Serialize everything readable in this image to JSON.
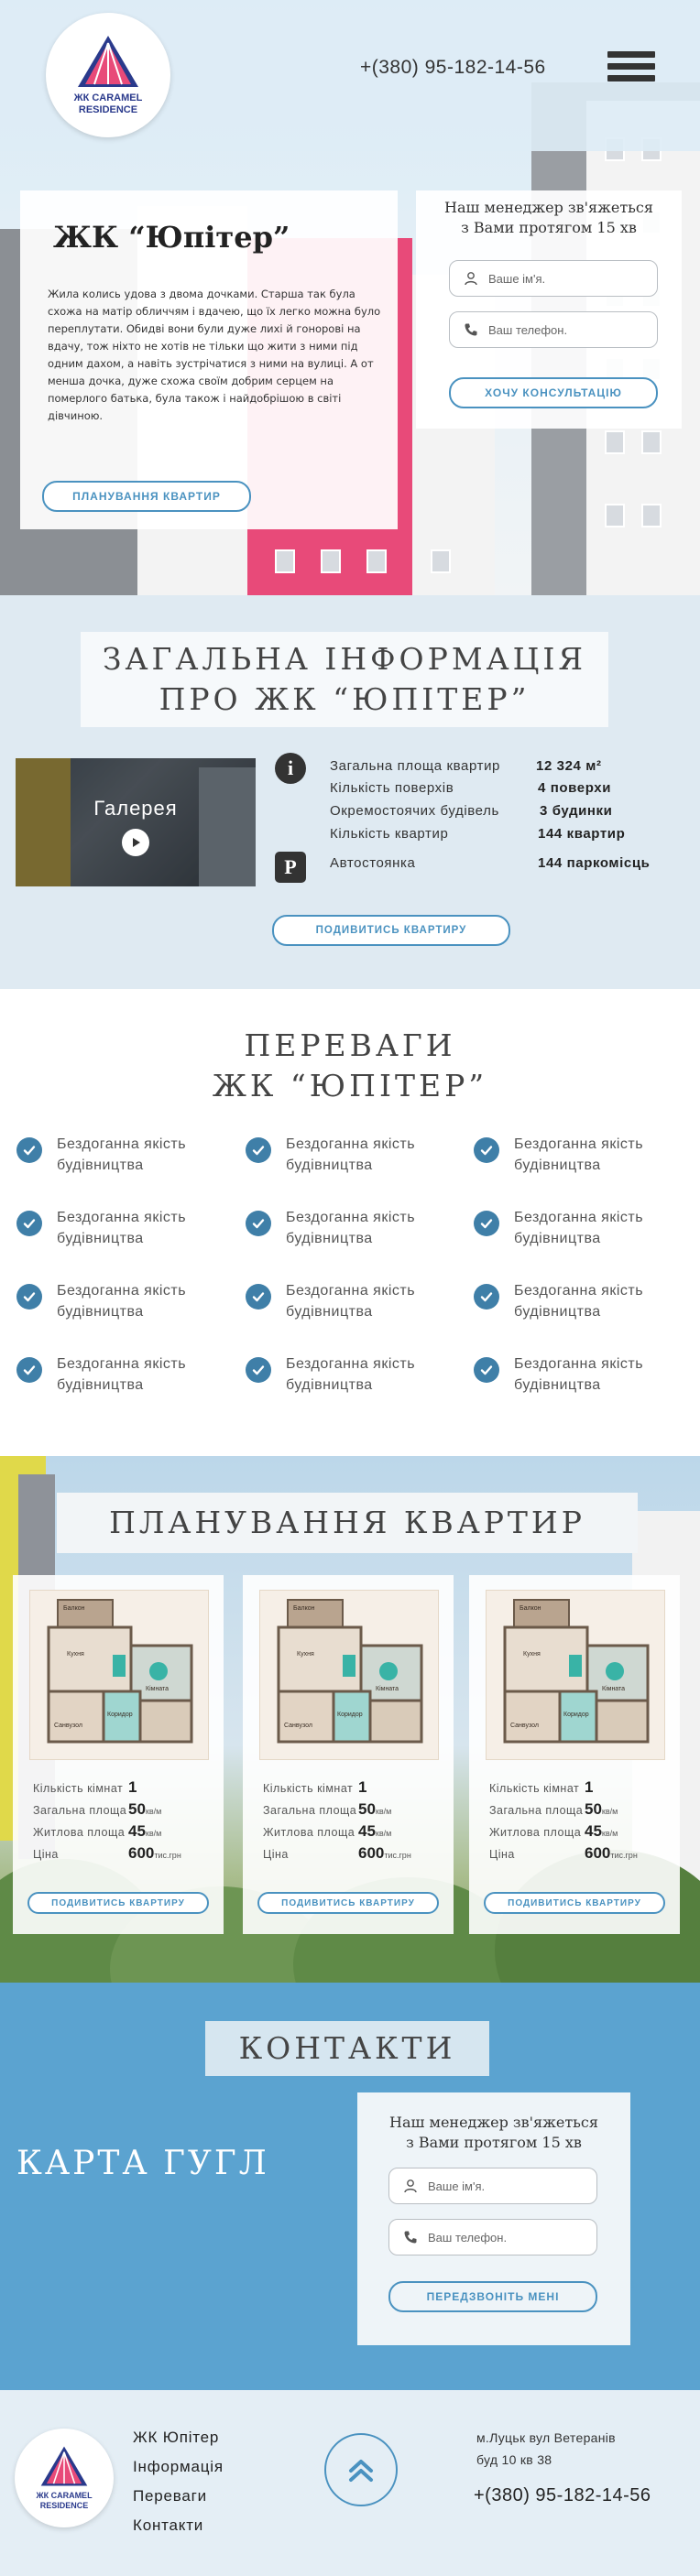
{
  "logo": {
    "line1": "ЖК CARAMEL",
    "line2": "RESIDENCE"
  },
  "header": {
    "phone": "+(380) 95-182-14-56"
  },
  "hero": {
    "title": "ЖК “Юпітер”",
    "text": "Жила колись удова з двома дочками. Старша так була схожа на матір обличчям і вдачею, що їх легко можна було переплутати. Обидві вони були дуже лихі й гонорові на вдачу, тож ніхто не хотів не тільки що жити з ними під одним дахом, а навіть зустрічатися з ними на вулиці. А от менша дочка, дуже схожа своїм добрим серцем на померлого батька, була також і найдобрішою в світі дівчиною.",
    "plan_button": "ПЛАНУВАННЯ КВАРТИР"
  },
  "hero_form": {
    "title_line1": "Наш менеджер зв'яжеться",
    "title_line2": "з Вами протягом 15 хв",
    "name_placeholder": "Ваше ім'я.",
    "phone_placeholder": "Ваш телефон.",
    "submit": "ХОЧУ КОНСУЛЬТАЦІЮ"
  },
  "info": {
    "title_line1": "ЗАГАЛЬНА ІНФОРМАЦІЯ",
    "title_line2": "ПРО ЖК “ЮПІТЕР”",
    "gallery_label": "Галерея",
    "rows": [
      {
        "label": "Загальна площа квартир",
        "value": "12 324 м²"
      },
      {
        "label": "Кількість поверхів",
        "value": "4 поверхи"
      },
      {
        "label": "Окремостоячих будівель",
        "value": "3 будинки"
      },
      {
        "label": "Кількість квартир",
        "value": "144 квартир"
      }
    ],
    "parking": {
      "label": "Автостоянка",
      "value": "144 паркомісць"
    },
    "button": "ПОДИВИТИСЬ КВАРТИРУ"
  },
  "advantages": {
    "title_line1": "ПЕРЕВАГИ",
    "title_line2": "ЖК “ЮПІТЕР”",
    "items": [
      "Бездоганна якість будівництва",
      "Бездоганна якість будівництва",
      "Бездоганна якість будівництва",
      "Бездоганна якість будівництва",
      "Бездоганна якість будівництва",
      "Бездоганна якість будівництва",
      "Бездоганна якість будівництва",
      "Бездоганна якість будівництва",
      "Бездоганна якість будівництва",
      "Бездоганна якість будівництва",
      "Бездоганна якість будівництва",
      "Бездоганна якість будівництва"
    ]
  },
  "plans": {
    "title": "ПЛАНУВАННЯ КВАРТИР",
    "labels": {
      "rooms": "Кількість кімнат",
      "total": "Загальна площа",
      "living": "Житлова площа",
      "price": "Ціна"
    },
    "units": {
      "area": "кв/м",
      "price": "тис.грн"
    },
    "plan_labels": {
      "balcony": "Балкон",
      "kitchen": "Кухня",
      "room": "Кімната",
      "hall": "Коридор",
      "bath": "Санвузол"
    },
    "cards": [
      {
        "rooms": "1",
        "total": "50",
        "living": "45",
        "price": "600",
        "button": "ПОДИВИТИСЬ КВАРТИРУ"
      },
      {
        "rooms": "1",
        "total": "50",
        "living": "45",
        "price": "600",
        "button": "ПОДИВИТИСЬ КВАРТИРУ"
      },
      {
        "rooms": "1",
        "total": "50",
        "living": "45",
        "price": "600",
        "button": "ПОДИВИТИСЬ КВАРТИРУ"
      }
    ]
  },
  "contacts": {
    "title": "КОНТАКТИ",
    "map_label": "КАРТА ГУГЛ",
    "form_title_line1": "Наш менеджер зв'яжеться",
    "form_title_line2": "з Вами протягом 15 хв",
    "name_placeholder": "Ваше ім'я.",
    "phone_placeholder": "Ваш телефон.",
    "submit": "ПЕРЕДЗВОНІТЬ МЕНІ"
  },
  "footer": {
    "links": [
      "ЖК Юпітер",
      "Інформація",
      "Переваги",
      "Контакти"
    ],
    "address_line1": "м.Луцьк вул Ветеранів",
    "address_line2": "буд 10 кв 38",
    "phone": "+(380) 95-182-14-56"
  },
  "colors": {
    "accent": "#4a92c0",
    "contacts_bg": "#5ba3d0",
    "info_bg": "#dfeaf2",
    "check": "#3f7fa8",
    "building_pink": "#e84a79"
  },
  "icons": [
    "phone-icon",
    "menu-icon",
    "user-icon",
    "phone-handset-icon",
    "info-icon",
    "parking-icon",
    "play-icon",
    "check-icon",
    "arrow-up-icon"
  ]
}
